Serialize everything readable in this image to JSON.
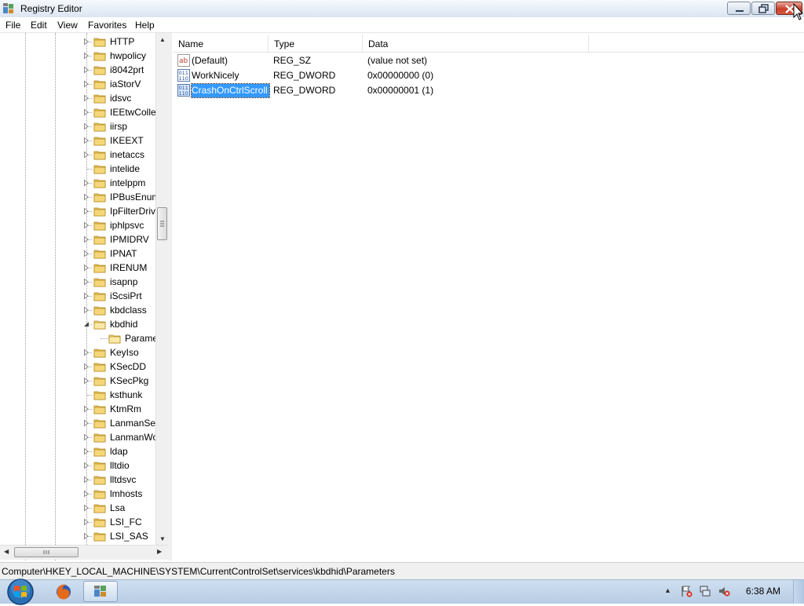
{
  "window": {
    "title": "Registry Editor"
  },
  "menu": [
    "File",
    "Edit",
    "View",
    "Favorites",
    "Help"
  ],
  "tree": {
    "items": [
      {
        "label": "HTTP",
        "expander": "collapsed"
      },
      {
        "label": "hwpolicy",
        "expander": "collapsed"
      },
      {
        "label": "i8042prt",
        "expander": "collapsed"
      },
      {
        "label": "iaStorV",
        "expander": "collapsed"
      },
      {
        "label": "idsvc",
        "expander": "collapsed"
      },
      {
        "label": "IEEtwColle",
        "expander": "collapsed"
      },
      {
        "label": "iirsp",
        "expander": "collapsed"
      },
      {
        "label": "IKEEXT",
        "expander": "collapsed"
      },
      {
        "label": "inetaccs",
        "expander": "collapsed"
      },
      {
        "label": "intelide",
        "expander": "none"
      },
      {
        "label": "intelppm",
        "expander": "collapsed"
      },
      {
        "label": "IPBusEnum",
        "expander": "collapsed"
      },
      {
        "label": "IpFilterDriv",
        "expander": "collapsed"
      },
      {
        "label": "iphlpsvc",
        "expander": "collapsed"
      },
      {
        "label": "IPMIDRV",
        "expander": "collapsed"
      },
      {
        "label": "IPNAT",
        "expander": "collapsed"
      },
      {
        "label": "IRENUM",
        "expander": "collapsed"
      },
      {
        "label": "isapnp",
        "expander": "collapsed"
      },
      {
        "label": "iScsiPrt",
        "expander": "collapsed"
      },
      {
        "label": "kbdclass",
        "expander": "collapsed"
      },
      {
        "label": "kbdhid",
        "expander": "expanded"
      },
      {
        "label": "Parame",
        "expander": "child"
      },
      {
        "label": "KeyIso",
        "expander": "collapsed"
      },
      {
        "label": "KSecDD",
        "expander": "collapsed"
      },
      {
        "label": "KSecPkg",
        "expander": "collapsed"
      },
      {
        "label": "ksthunk",
        "expander": "none"
      },
      {
        "label": "KtmRm",
        "expander": "collapsed"
      },
      {
        "label": "LanmanSer",
        "expander": "collapsed"
      },
      {
        "label": "LanmanWo",
        "expander": "collapsed"
      },
      {
        "label": "ldap",
        "expander": "collapsed"
      },
      {
        "label": "lltdio",
        "expander": "collapsed"
      },
      {
        "label": "lltdsvc",
        "expander": "collapsed"
      },
      {
        "label": "lmhosts",
        "expander": "collapsed"
      },
      {
        "label": "Lsa",
        "expander": "collapsed"
      },
      {
        "label": "LSI_FC",
        "expander": "collapsed"
      },
      {
        "label": "LSI_SAS",
        "expander": "collapsed"
      }
    ]
  },
  "list": {
    "columns": [
      "Name",
      "Type",
      "Data"
    ],
    "rows": [
      {
        "name": "(Default)",
        "type": "REG_SZ",
        "data": "(value not set)",
        "icon": "string-value-icon"
      },
      {
        "name": "WorkNicely",
        "type": "REG_DWORD",
        "data": "0x00000000 (0)",
        "icon": "binary-value-icon"
      },
      {
        "name": "CrashOnCtrlScroll",
        "type": "REG_DWORD",
        "data": "0x00000001 (1)",
        "icon": "binary-value-icon",
        "selected": true
      }
    ]
  },
  "status": {
    "path": "Computer\\HKEY_LOCAL_MACHINE\\SYSTEM\\CurrentControlSet\\services\\kbdhid\\Parameters"
  },
  "taskbar": {
    "clock": "6:38 AM"
  },
  "colors": {
    "selection": "#3399ff",
    "titlebar": "#dbe5f2",
    "close": "#c7412d"
  }
}
